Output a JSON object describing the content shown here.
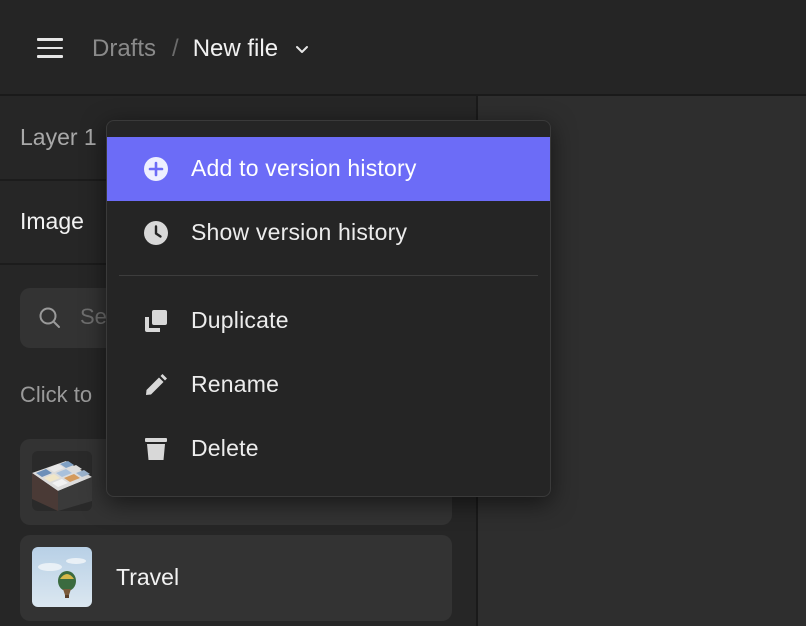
{
  "header": {
    "menu_icon": "hamburger-icon",
    "breadcrumb_parent": "Drafts",
    "breadcrumb_separator": "/",
    "file_name": "New file",
    "file_menu_icon": "chevron-down-icon"
  },
  "left_panel": {
    "layer_label": "Layer 1",
    "image_label": "Image",
    "search_placeholder": "Se",
    "hint_text": "Click to",
    "images": [
      {
        "label": "",
        "thumb": "cube-thumbnail"
      },
      {
        "label": "Travel",
        "thumb": "balloon-thumbnail"
      }
    ]
  },
  "context_menu": {
    "items": [
      {
        "label": "Add to version history",
        "icon": "plus-circle-icon",
        "active": true
      },
      {
        "label": "Show version history",
        "icon": "clock-icon",
        "active": false
      },
      {
        "label": "Duplicate",
        "icon": "duplicate-icon",
        "active": false
      },
      {
        "label": "Rename",
        "icon": "pencil-icon",
        "active": false
      },
      {
        "label": "Delete",
        "icon": "trash-icon",
        "active": false
      }
    ]
  },
  "colors": {
    "accent": "#6c6cf7",
    "background": "#2c2c2c",
    "panel": "#262626",
    "menu": "#252525"
  }
}
